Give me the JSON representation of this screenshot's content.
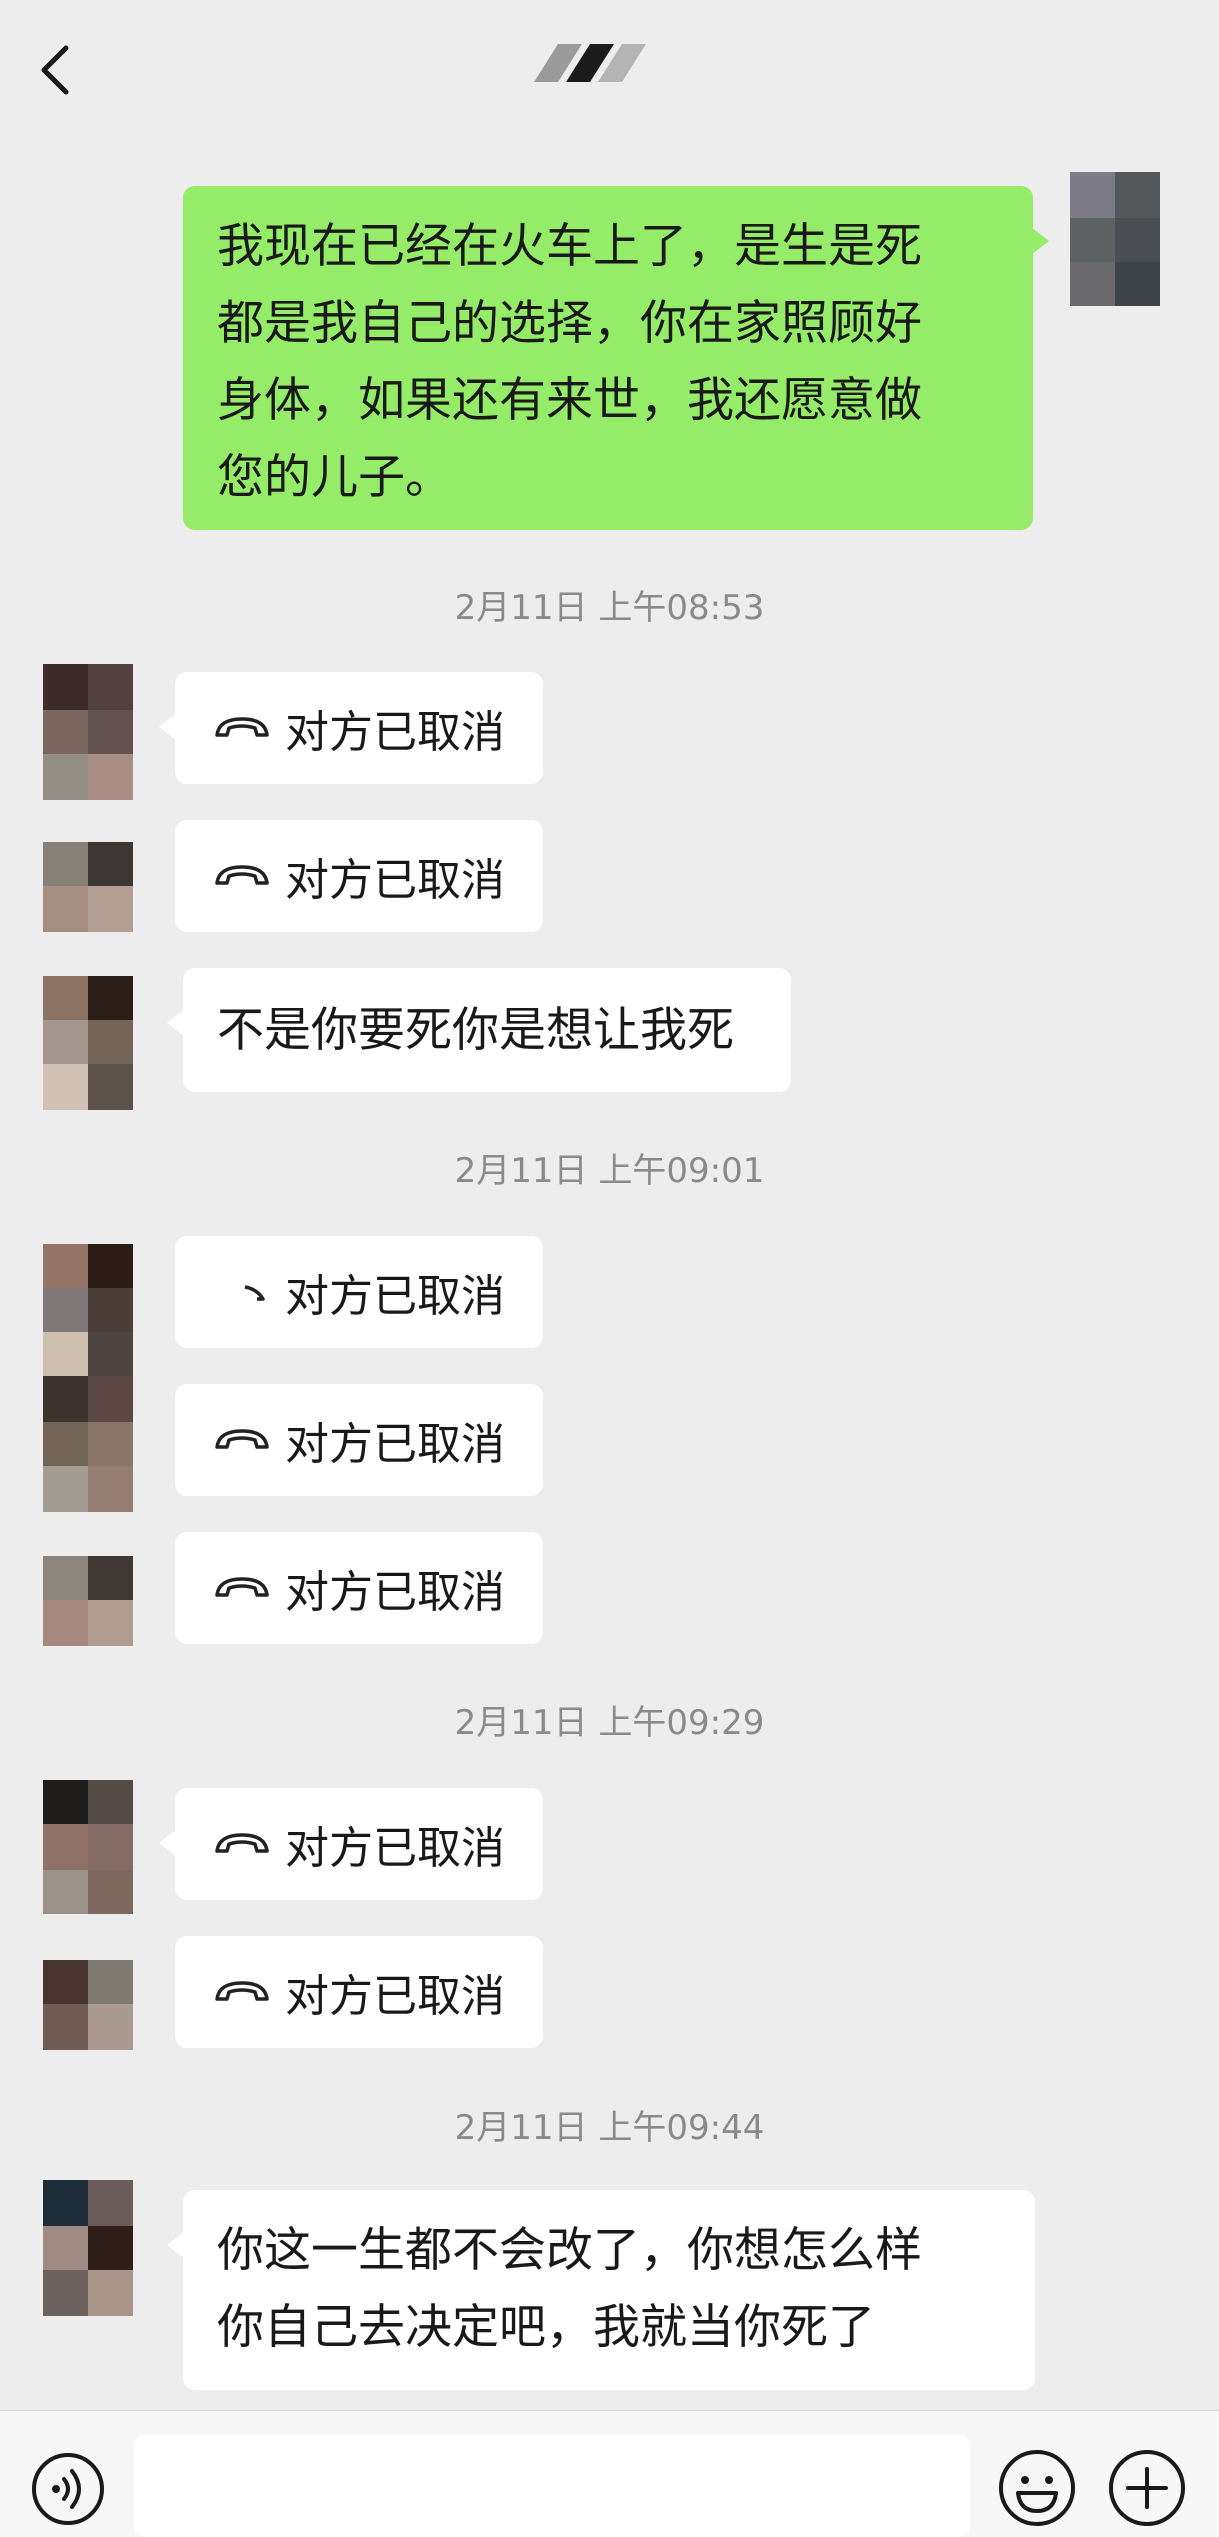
{
  "header": {
    "back_icon": "chevron-left-icon",
    "title_icon": "pixelated-title"
  },
  "messages": [
    {
      "type": "text",
      "direction": "out",
      "text": "我现在已经在火车上了，是生是死\n都是我自己的选择，你在家照顾好\n身体，如果还有来世，我还愿意做\n您的儿子。"
    },
    {
      "type": "timestamp",
      "text": "2月11日 上午08:53"
    },
    {
      "type": "call",
      "direction": "in",
      "text": "对方已取消"
    },
    {
      "type": "call",
      "direction": "in",
      "text": "对方已取消"
    },
    {
      "type": "text",
      "direction": "in",
      "text": "不是你要死你是想让我死"
    },
    {
      "type": "timestamp",
      "text": "2月11日 上午09:01"
    },
    {
      "type": "call",
      "direction": "in",
      "text": "对方已取消"
    },
    {
      "type": "call",
      "direction": "in",
      "text": "对方已取消"
    },
    {
      "type": "call",
      "direction": "in",
      "text": "对方已取消"
    },
    {
      "type": "timestamp",
      "text": "2月11日 上午09:29"
    },
    {
      "type": "call",
      "direction": "in",
      "text": "对方已取消"
    },
    {
      "type": "call",
      "direction": "in",
      "text": "对方已取消"
    },
    {
      "type": "timestamp",
      "text": "2月11日 上午09:44"
    },
    {
      "type": "text",
      "direction": "in",
      "text": "你这一生都不会改了，你想怎么样\n你自己去决定吧，我就当你死了"
    }
  ],
  "input_bar": {
    "voice_icon": "voice-icon",
    "input_value": "",
    "emoji_icon": "emoji-icon",
    "plus_icon": "plus-icon"
  },
  "colors": {
    "background": "#ededed",
    "outgoing_bubble": "#95ec69",
    "incoming_bubble": "#ffffff",
    "timestamp_text": "#8a8a8a"
  }
}
